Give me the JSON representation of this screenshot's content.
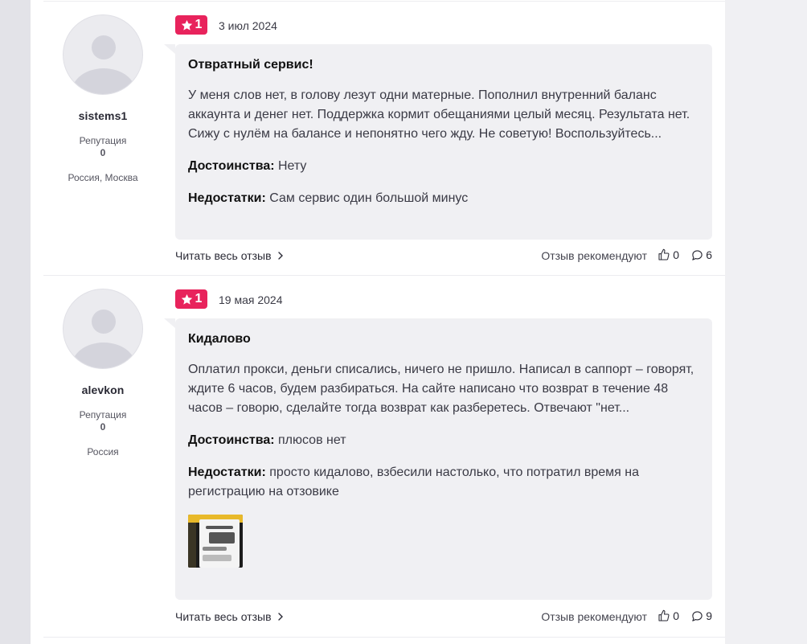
{
  "reviews": [
    {
      "author": {
        "username": "sistems1",
        "reputation_label": "Репутация",
        "reputation_value": "0",
        "location": "Россия, Москва"
      },
      "rating": "1",
      "date": "3 июл 2024",
      "title": "Отвратный сервис!",
      "text": "У меня слов нет, в голову лезут одни матерные. Пополнил внутренний баланс аккаунта и денег нет. Поддержка кормит обещаниями целый месяц. Результата нет. Сижу с нулём на балансе и непонятно чего жду. Не советую! Воспользуйтесь...",
      "pros_label": "Достоинства:",
      "pros": "Нету",
      "cons_label": "Недостатки:",
      "cons": "Сам сервис один большой минус",
      "read_more": "Читать весь отзыв",
      "recommend_label": "Отзыв рекомендуют",
      "likes": "0",
      "comments": "6"
    },
    {
      "author": {
        "username": "alevkon",
        "reputation_label": "Репутация",
        "reputation_value": "0",
        "location": "Россия"
      },
      "rating": "1",
      "date": "19 мая 2024",
      "title": "Кидалово",
      "text": "Оплатил прокси, деньги списались, ничего не пришло. Написал в саппорт – говорят, ждите 6 часов, будем разбираться. На сайте написано что возврат в течение 48 часов – говорю, сделайте тогда возврат как разберетесь. Отвечают \"нет...",
      "pros_label": "Достоинства:",
      "pros": "плюсов нет",
      "cons_label": "Недостатки:",
      "cons": "просто кидалово, взбесили настолько, что потратил время на регистрацию на отзовике",
      "read_more": "Читать весь отзыв",
      "recommend_label": "Отзыв рекомендуют",
      "likes": "0",
      "comments": "9"
    }
  ],
  "colors": {
    "badge": "#e8235c",
    "bubble": "#f0f0f3",
    "page_bg": "#ffffff",
    "outer_bg": "#f0f0f3"
  },
  "icons": {
    "star": "star-icon",
    "chevron": "chevron-right-icon",
    "like": "thumbs-up-icon",
    "comment": "comment-icon",
    "avatar": "default-avatar-icon"
  }
}
